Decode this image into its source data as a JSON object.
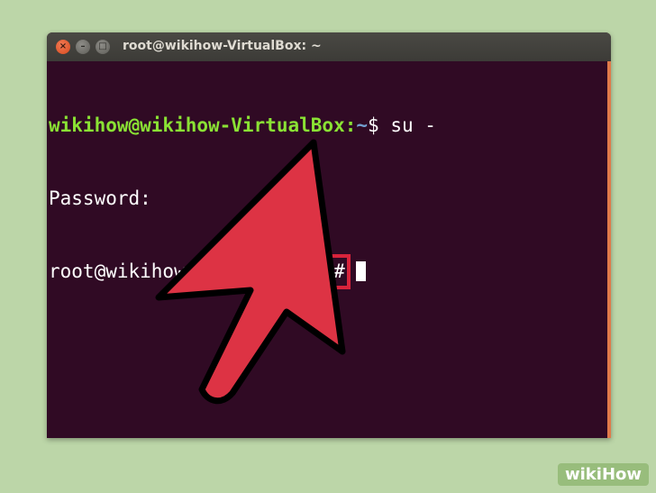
{
  "window": {
    "title": "root@wikihow-VirtualBox: ~",
    "close_glyph": "×",
    "min_glyph": "–",
    "max_glyph": "□"
  },
  "terminal": {
    "line1_userhost": "wikihow@wikihow-VirtualBox",
    "line1_colon": ":",
    "line1_path": "~",
    "line1_prompt": "$ su -",
    "line2": "Password:",
    "line3_prompt": "root@wikihow-VirtualBox:",
    "line3_highlight": "~#"
  },
  "annotation": {
    "arrow_color": "#dd3344",
    "highlight_color": "#d8233b"
  },
  "watermark": {
    "part1": "wiki",
    "part2": "How"
  },
  "colors": {
    "background": "#bcd6a8",
    "terminal_bg": "#300a24",
    "user_green": "#8ae234",
    "path_blue": "#729fcf"
  }
}
